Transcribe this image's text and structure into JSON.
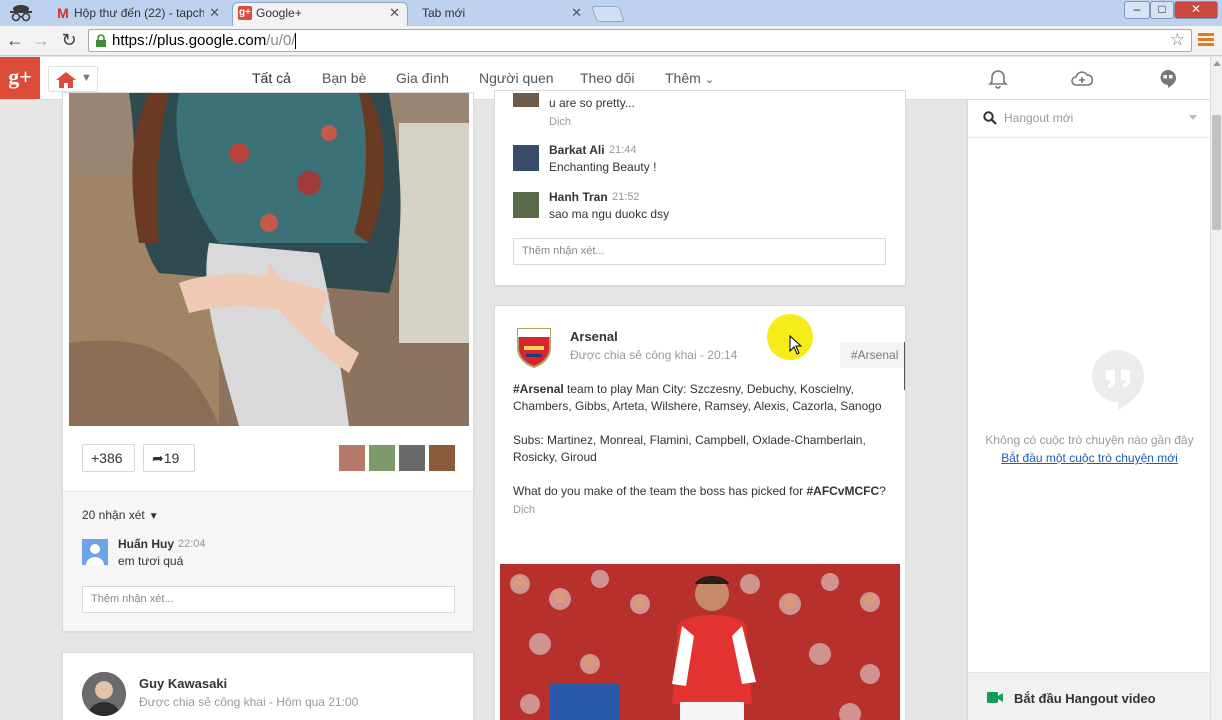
{
  "browser": {
    "tabs": [
      {
        "title": "Hộp thư đến (22) - tapchi",
        "favicon": "gmail-icon"
      },
      {
        "title": "Google+",
        "favicon": "gplus-icon"
      },
      {
        "title": "Tab mới",
        "favicon": ""
      }
    ],
    "active_tab": 1,
    "url": {
      "host": "https://plus.google.com",
      "path": "/u/0/"
    },
    "window_controls": {
      "minimize": "–",
      "maximize": "□",
      "close": "✕"
    }
  },
  "gplus": {
    "logo": "g+",
    "nav_tabs": [
      "Tất cả",
      "Bạn bè",
      "Gia đình",
      "Người quen",
      "Theo dõi",
      "Thêm"
    ],
    "active_nav": "Tất cả",
    "accent": "#427fed",
    "brand": "#dd4b39"
  },
  "photo_post": {
    "plus_count": "+386",
    "share_count": "19",
    "comment_count": "20 nhận xét",
    "comment": {
      "author": "Huấn Huy",
      "time": "22:04",
      "text": "em tươi quá"
    },
    "add_comment_placeholder": "Thêm nhận xét..."
  },
  "guy_post": {
    "author": "Guy Kawasaki",
    "meta": "Được chia sẻ công khai  -  Hôm qua 21:00"
  },
  "comments_card": {
    "partial_comment": {
      "text": "u are so pretty...",
      "translate": "Dịch"
    },
    "comments": [
      {
        "author": "Barkat Ali",
        "time": "21:44",
        "text": "Enchanting Beauty !"
      },
      {
        "author": "Hanh Tran",
        "time": "21:52",
        "text": "sao ma ngu duokc dsy"
      }
    ],
    "add_comment_placeholder": "Thêm nhận xét..."
  },
  "arsenal_post": {
    "author": "Arsenal",
    "meta": "Được chia sẻ công khai  -  20:14",
    "hashtag": "#Arsenal",
    "lines": [
      {
        "tag": "#Arsenal",
        "text": " team to play Man City: Szczesny, Debuchy, Koscielny,"
      },
      {
        "tag": "",
        "text": "Chambers, Gibbs, Arteta, Wilshere, Ramsey, Alexis, Cazorla, Sanogo"
      },
      {
        "tag": "",
        "text": "Subs: Martinez, Monreal, Flamini, Campbell, Oxlade-Chamberlain,"
      },
      {
        "tag": "",
        "text": "Rosicky, Giroud"
      },
      {
        "tag": "",
        "text": "What do you make of the team the boss has picked for "
      }
    ],
    "question_tag": "#AFCvMCFC",
    "question_end": "?",
    "translate": "Dịch"
  },
  "hangouts": {
    "search_placeholder": "Hangout mới",
    "empty_text": "Không có cuộc trò chuyện nào gần đây",
    "start_link": "Bắt đầu một cuộc trò chuyện mới",
    "video_button": "Bắt đầu Hangout video"
  }
}
